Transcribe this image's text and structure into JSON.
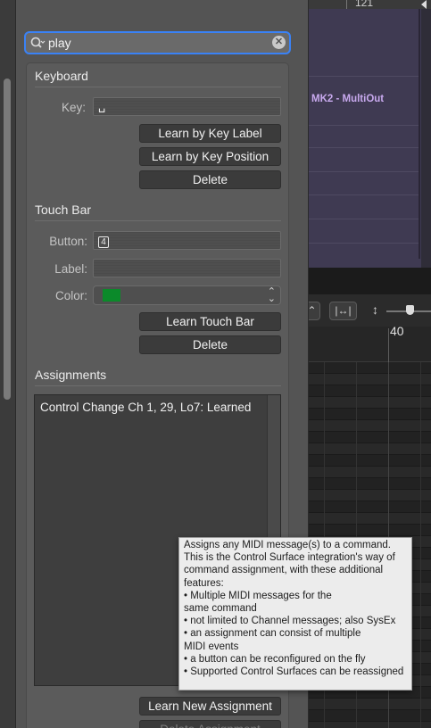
{
  "background": {
    "ruler_top_number": "121",
    "region_name": "MK2 - MultiOut",
    "ruler_bar_number": "40",
    "region_color": "#3f3a52",
    "region_text_color": "#c8a9ee"
  },
  "search": {
    "value": "play",
    "accent_color": "#3a82f6"
  },
  "keyboard": {
    "section_title": "Keyboard",
    "key_label": "Key:",
    "key_value": "␣",
    "learn_key_label_button": "Learn by Key Label",
    "learn_key_position_button": "Learn by Key Position",
    "delete_button": "Delete"
  },
  "touchbar": {
    "section_title": "Touch Bar",
    "button_label": "Button:",
    "button_value": "4",
    "label_label": "Label:",
    "label_value": "",
    "color_label": "Color:",
    "color_value": "#0b8a2a",
    "learn_touchbar_button": "Learn Touch Bar",
    "delete_button": "Delete"
  },
  "assignments": {
    "section_title": "Assignments",
    "items": [
      "Control Change Ch 1, 29, Lo7: Learned"
    ],
    "learn_new_button": "Learn New Assignment",
    "delete_assignment_button": "Delete Assignment"
  },
  "tooltip": {
    "lines": [
      "Assigns any MIDI message(s) to a command.",
      "This is the Control Surface integration's way of",
      "command assignment, with these additional",
      "features:",
      "• Multiple MIDI messages for the",
      "same command",
      "• not limited to Channel messages; also SysEx",
      "• an assignment can consist of multiple",
      "MIDI events",
      "• a button can be reconfigured on the fly",
      "• Supported Control Surfaces can be reassigned"
    ]
  }
}
